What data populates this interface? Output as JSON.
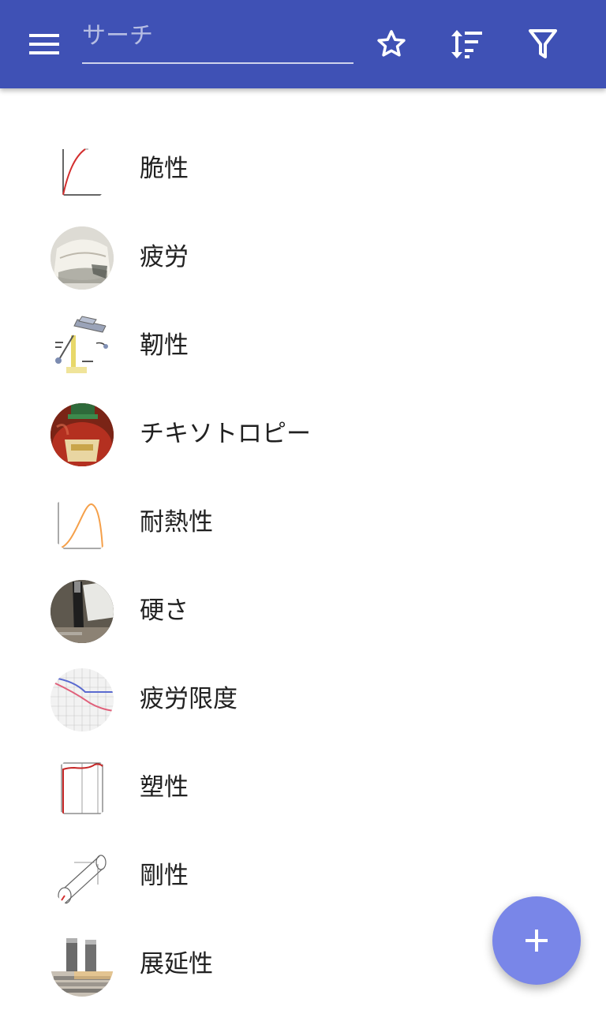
{
  "appbar": {
    "color": "#3f51b5",
    "menu_icon": "menu-icon",
    "search": {
      "placeholder": "サーチ",
      "value": ""
    },
    "actions": [
      "star-icon",
      "sort-icon",
      "filter-icon"
    ]
  },
  "items": [
    {
      "label": "脆性",
      "icon": "curve-graph-thumbnail"
    },
    {
      "label": "疲労",
      "icon": "fatigue-photo-thumbnail"
    },
    {
      "label": "靭性",
      "icon": "pendulum-diagram-thumbnail"
    },
    {
      "label": "チキソトロピー",
      "icon": "ketchup-bottle-thumbnail"
    },
    {
      "label": "耐熱性",
      "icon": "orange-curve-thumbnail"
    },
    {
      "label": "硬さ",
      "icon": "hardness-tester-thumbnail"
    },
    {
      "label": "疲労限度",
      "icon": "sn-curve-thumbnail"
    },
    {
      "label": "塑性",
      "icon": "stress-strain-thumbnail"
    },
    {
      "label": "剛性",
      "icon": "cylinder-diagram-thumbnail"
    },
    {
      "label": "展延性",
      "icon": "metal-rods-thumbnail"
    }
  ],
  "fab": {
    "icon": "plus-icon",
    "color": "#7986e8"
  }
}
